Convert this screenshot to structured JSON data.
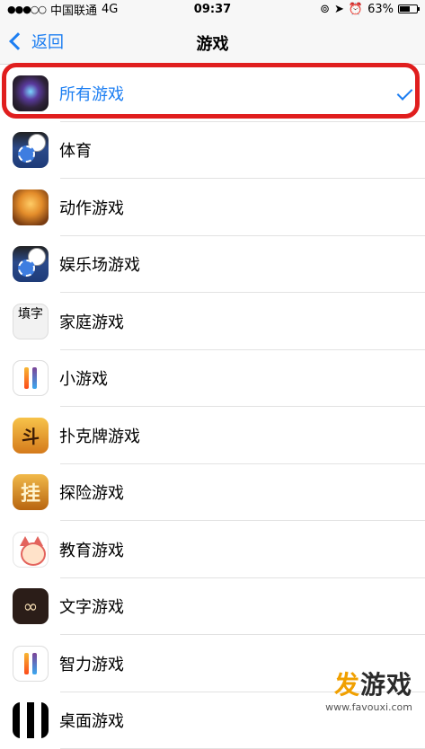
{
  "status_bar": {
    "signal": "●●●○○",
    "carrier": "中国联通",
    "network": "4G",
    "time": "09:37",
    "icons": [
      "rotation-lock-icon",
      "location-arrow-icon",
      "alarm-icon"
    ],
    "battery_percent": "63%",
    "battery_level": 0.63
  },
  "nav": {
    "back_label": "返回",
    "title": "游戏"
  },
  "list": [
    {
      "label": "所有游戏",
      "icon": "all-games-icon",
      "selected": true
    },
    {
      "label": "体育",
      "icon": "sports-icon"
    },
    {
      "label": "动作游戏",
      "icon": "action-games-icon"
    },
    {
      "label": "娱乐场游戏",
      "icon": "casino-games-icon"
    },
    {
      "label": "家庭游戏",
      "icon": "family-games-icon",
      "icon_text": "填字"
    },
    {
      "label": "小游戏",
      "icon": "ios11-icon"
    },
    {
      "label": "扑克牌游戏",
      "icon": "poker-games-icon",
      "icon_text": "斗"
    },
    {
      "label": "探险游戏",
      "icon": "adventure-games-icon",
      "icon_text": "挂"
    },
    {
      "label": "教育游戏",
      "icon": "educational-games-icon"
    },
    {
      "label": "文字游戏",
      "icon": "infinity-icon",
      "icon_text": "∞"
    },
    {
      "label": "智力游戏",
      "icon": "ios11-icon"
    },
    {
      "label": "桌面游戏",
      "icon": "desktop-games-icon"
    }
  ],
  "colors": {
    "accent": "#1c7ef2",
    "highlight": "#e01e1e"
  },
  "watermark": {
    "accent_char": "发",
    "title_rest": "游戏",
    "site": "www.favouxi.com"
  }
}
